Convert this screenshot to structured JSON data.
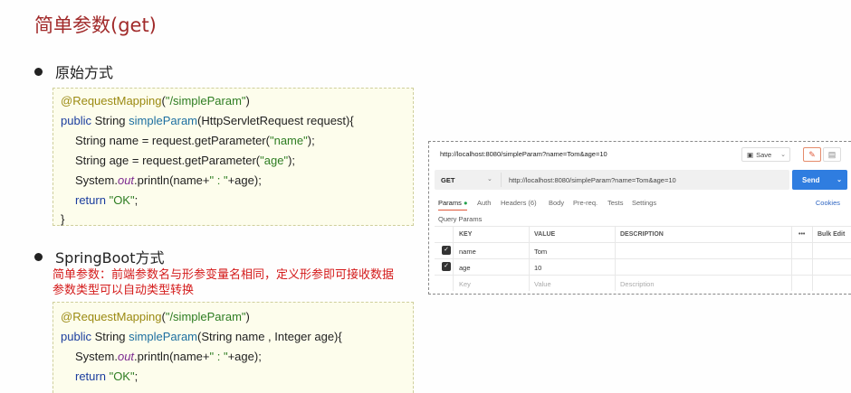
{
  "slide": {
    "title": "简单参数(get)",
    "bullet1": "原始方式",
    "bullet2": "SpringBoot方式",
    "note_line1": "简单参数：前端参数名与形参变量名相同，定义形参即可接收数据",
    "note_line2": "参数类型可以自动类型转换"
  },
  "code1": {
    "l1_ann": "@RequestMapping",
    "l1_open": "(",
    "l1_str": "\"/simpleParam\"",
    "l1_close": ")",
    "l2_kw": "public",
    "l2_type": " String ",
    "l2_fn": "simpleParam",
    "l2_rest": "(HttpServletRequest request){",
    "l3_a": "String name = request.getParameter(",
    "l3_str": "\"name\"",
    "l3_b": ");",
    "l4_a": "String age = request.getParameter(",
    "l4_str": "\"age\"",
    "l4_b": ");",
    "l5_a": "System.",
    "l5_it": "out",
    "l5_b": ".println(name+",
    "l5_str": "\" : \"",
    "l5_c": "+age);",
    "l6_kw": "return ",
    "l6_str": "\"OK\"",
    "l6_b": ";",
    "l7": "}"
  },
  "code2": {
    "l1_ann": "@RequestMapping",
    "l1_open": "(",
    "l1_str": "\"/simpleParam\"",
    "l1_close": ")",
    "l2_kw": "public",
    "l2_type": " String ",
    "l2_fn": "simpleParam",
    "l2_rest": "(String name , Integer age){",
    "l3_a": "System.",
    "l3_it": "out",
    "l3_b": ".println(name+",
    "l3_str": "\" : \"",
    "l3_c": "+age);",
    "l4_kw": "return ",
    "l4_str": "\"OK\"",
    "l4_b": ";"
  },
  "postman": {
    "url_title": "http://localhost:8080/simpleParam?name=Tom&age=10",
    "save_label": "Save",
    "method": "GET",
    "request_url": "http://localhost:8080/simpleParam?name=Tom&age=10",
    "send_label": "Send",
    "tabs": {
      "params": "Params",
      "auth": "Auth",
      "headers": "Headers (6)",
      "body": "Body",
      "prereq": "Pre-req.",
      "tests": "Tests",
      "settings": "Settings"
    },
    "cookies": "Cookies",
    "query_params_label": "Query Params",
    "columns": {
      "key": "KEY",
      "value": "VALUE",
      "description": "DESCRIPTION",
      "more": "•••",
      "bulk_edit": "Bulk Edit"
    },
    "rows": [
      {
        "key": "name",
        "value": "Tom",
        "checked": true
      },
      {
        "key": "age",
        "value": "10",
        "checked": true
      }
    ],
    "placeholders": {
      "key": "Key",
      "value": "Value",
      "description": "Description"
    },
    "accent_color": "#2f7de0"
  }
}
